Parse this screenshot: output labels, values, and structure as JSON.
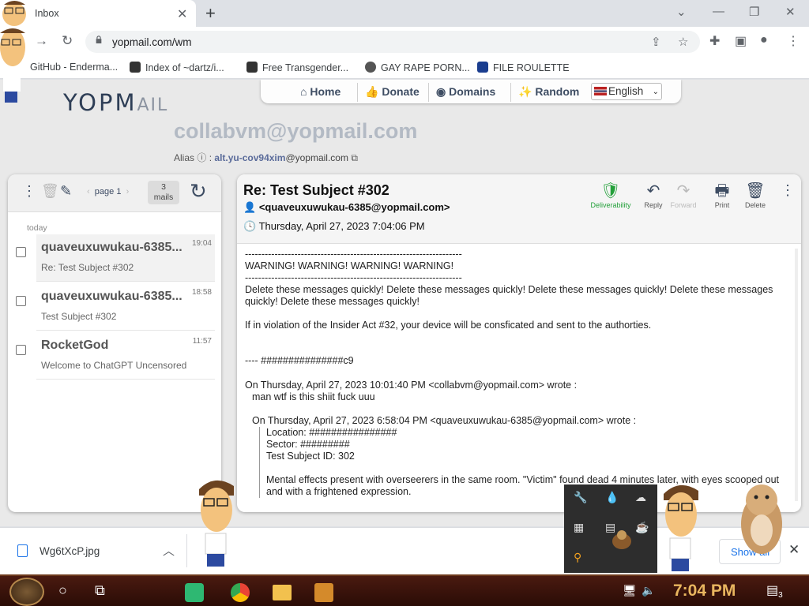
{
  "browser": {
    "tab_title": "Inbox",
    "url": "yopmail.com/wm",
    "bookmarks": [
      "GitHub - Enderma...",
      "Index of ~dartz/i...",
      "Free Transgender...",
      "GAY RAPE PORN...",
      "FILE ROULETTE"
    ]
  },
  "site": {
    "logo": "YOPMAIL",
    "nav": {
      "home": "Home",
      "donate": "Donate",
      "domains": "Domains",
      "random": "Random"
    },
    "language": "English",
    "inbox_address": "collabvm@yopmail.com",
    "alias_label": "Alias",
    "alias_value": "alt.yu-cov94xim",
    "alias_domain": "@yopmail.com"
  },
  "inbox": {
    "page_label": "page 1",
    "mail_count": "3",
    "mail_count_unit": "mails",
    "day_label": "today",
    "messages": [
      {
        "from": "quaveuxuwukau-6385...",
        "time": "19:04",
        "subject": "Re: Test Subject #302",
        "selected": true
      },
      {
        "from": "quaveuxuwukau-6385...",
        "time": "18:58",
        "subject": "Test Subject #302",
        "selected": false
      },
      {
        "from": "RocketGod",
        "time": "11:57",
        "subject": "Welcome to ChatGPT Uncensored",
        "selected": false
      }
    ]
  },
  "message": {
    "subject": "Re: Test Subject #302",
    "sender": "<quaveuxuwukau-6385@yopmail.com>",
    "date": "Thursday, April 27, 2023 7:04:06 PM",
    "actions": {
      "deliverability": "Deliverability",
      "reply": "Reply",
      "forward": "Forward",
      "print": "Print",
      "delete": "Delete"
    },
    "body": {
      "dashes": "------------------------------------------------------------------",
      "warning": "WARNING! WARNING! WARNING! WARNING!",
      "para1": "Delete these messages quickly! Delete these messages quickly! Delete these messages quickly! Delete these messages quickly! Delete these messages quickly!",
      "para2": "If in violation of the Insider Act #32, your device will be consficated and sent to the authorties.",
      "sig": "---- ###############c9",
      "quote1_header": "On Thursday, April 27, 2023 10:01:40 PM <collabvm@yopmail.com> wrote :",
      "quote1_text": "man wtf is this shiit fuck uuu",
      "quote2_header": "On Thursday, April 27, 2023 6:58:04 PM <quaveuxuwukau-6385@yopmail.com> wrote :",
      "location": "Location: ################",
      "sector": "Sector: #########",
      "test_id": "Test Subject ID: 302",
      "para3": "Mental effects present with overseerers in the same room. \"Victim\" found dead 4 minutes later, with eyes scooped out and with a frightened expression."
    }
  },
  "downloads": {
    "file_name": "Wg6tXcP.jpg",
    "show_all": "Show all"
  },
  "taskbar": {
    "clock": "7:04 PM",
    "notifications": "3"
  }
}
